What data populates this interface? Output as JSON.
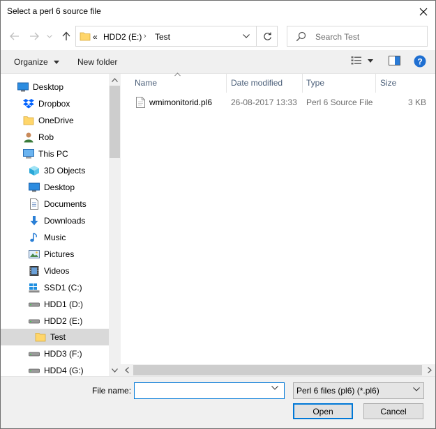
{
  "window": {
    "title": "Select a perl 6 source file"
  },
  "address": {
    "overflow": "«",
    "crumbs": [
      "HDD2 (E:)",
      "Test"
    ]
  },
  "search": {
    "placeholder": "Search Test"
  },
  "toolbar": {
    "organize": "Organize",
    "new_folder": "New folder"
  },
  "navpane": {
    "items": [
      {
        "label": "Desktop",
        "icon": "desktop-icon"
      },
      {
        "label": "Dropbox",
        "icon": "dropbox-icon"
      },
      {
        "label": "OneDrive",
        "icon": "folder-icon"
      },
      {
        "label": "Rob",
        "icon": "user-icon"
      },
      {
        "label": "This PC",
        "icon": "computer-icon"
      },
      {
        "label": "3D Objects",
        "icon": "cube-icon"
      },
      {
        "label": "Desktop",
        "icon": "desktop-icon"
      },
      {
        "label": "Documents",
        "icon": "documents-icon"
      },
      {
        "label": "Downloads",
        "icon": "download-icon"
      },
      {
        "label": "Music",
        "icon": "music-icon"
      },
      {
        "label": "Pictures",
        "icon": "pictures-icon"
      },
      {
        "label": "Videos",
        "icon": "videos-icon"
      },
      {
        "label": "SSD1 (C:)",
        "icon": "windows-drive-icon"
      },
      {
        "label": "HDD1 (D:)",
        "icon": "drive-icon"
      },
      {
        "label": "HDD2 (E:)",
        "icon": "drive-icon"
      },
      {
        "label": "Test",
        "icon": "folder-icon"
      },
      {
        "label": "HDD3 (F:)",
        "icon": "drive-icon"
      },
      {
        "label": "HDD4 (G:)",
        "icon": "drive-icon"
      }
    ],
    "selected": "Test"
  },
  "columns": [
    "Name",
    "Date modified",
    "Type",
    "Size"
  ],
  "files": [
    {
      "name": "wmimonitorid.pl6",
      "date": "26-08-2017 13:33",
      "type": "Perl 6 Source File",
      "size": "3 KB"
    }
  ],
  "footer": {
    "file_name_label": "File name:",
    "file_name_value": "",
    "filter": "Perl 6 files (pl6) (*.pl6)",
    "open": "Open",
    "cancel": "Cancel"
  },
  "colors": {
    "accent": "#0078d7",
    "selection": "#d9d9d9",
    "header_text": "#4c607a"
  }
}
